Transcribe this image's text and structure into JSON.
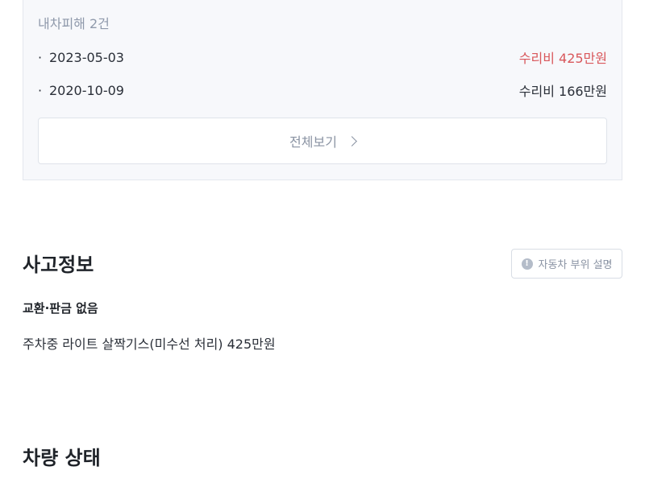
{
  "damage_card": {
    "title": "내차피해 2건",
    "items": [
      {
        "bullet": "·",
        "date": "2023-05-03",
        "amount": "수리비 425만원",
        "amount_color": "#d9575b"
      },
      {
        "bullet": "·",
        "date": "2020-10-09",
        "amount": "수리비 166만원",
        "amount_color": "#2a2f38"
      }
    ],
    "view_all_label": "전체보기"
  },
  "accident_info": {
    "title": "사고정보",
    "help_icon_glyph": "!",
    "help_button_label": "자동차 부위 설명",
    "subheading": "교환·판금 없음",
    "description": "주차중 라이트 살짝기스(미수선 처리) 425만원"
  },
  "vehicle_condition": {
    "title": "차량 상태"
  }
}
